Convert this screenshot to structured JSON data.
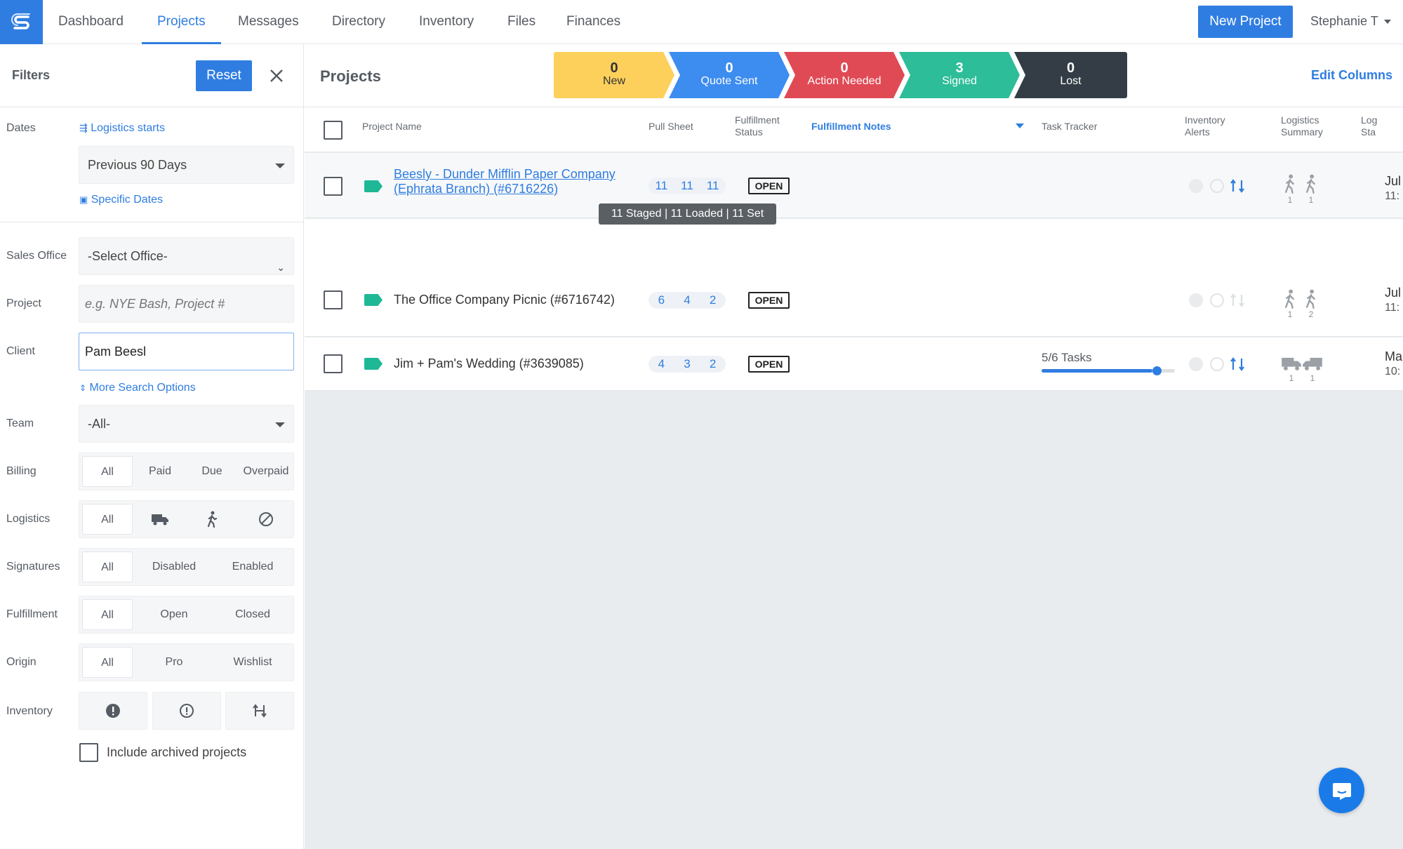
{
  "nav": {
    "items": [
      "Dashboard",
      "Projects",
      "Messages",
      "Directory",
      "Inventory",
      "Files",
      "Finances"
    ],
    "active": "Projects",
    "new_project": "New Project",
    "user": "Stephanie T"
  },
  "filters": {
    "title": "Filters",
    "reset": "Reset",
    "dates_label": "Dates",
    "logistics_starts": "Logistics starts",
    "date_range": "Previous 90 Days",
    "specific_dates": "Specific Dates",
    "sales_office_label": "Sales Office",
    "sales_office_value": "-Select Office-",
    "project_label": "Project",
    "project_placeholder": "e.g. NYE Bash, Project #",
    "client_label": "Client",
    "client_value": "Pam Beesl",
    "more_search": "More Search Options",
    "team_label": "Team",
    "team_value": "-All-",
    "billing_label": "Billing",
    "billing_options": [
      "All",
      "Paid",
      "Due",
      "Overpaid"
    ],
    "logistics_label": "Logistics",
    "logistics_all": "All",
    "signatures_label": "Signatures",
    "signatures_options": [
      "All",
      "Disabled",
      "Enabled"
    ],
    "fulfillment_label": "Fulfillment",
    "fulfillment_options": [
      "All",
      "Open",
      "Closed"
    ],
    "origin_label": "Origin",
    "origin_options": [
      "All",
      "Pro",
      "Wishlist"
    ],
    "inventory_label": "Inventory",
    "include_archived": "Include archived projects"
  },
  "main": {
    "title": "Projects",
    "edit_columns": "Edit Columns",
    "stages": [
      {
        "count": "0",
        "name": "New",
        "color": "#fdd05c"
      },
      {
        "count": "0",
        "name": "Quote Sent",
        "color": "#3d8cf0"
      },
      {
        "count": "0",
        "name": "Action Needed",
        "color": "#e04a55"
      },
      {
        "count": "3",
        "name": "Signed",
        "color": "#2dbd98"
      },
      {
        "count": "0",
        "name": "Lost",
        "color": "#343d45"
      }
    ],
    "columns": {
      "project_name": "Project Name",
      "pull_sheet": "Pull Sheet",
      "fulfillment_status_1": "Fulfillment",
      "fulfillment_status_2": "Status",
      "fulfillment_notes": "Fulfillment Notes",
      "task_tracker": "Task Tracker",
      "inventory_alerts_1": "Inventory",
      "inventory_alerts_2": "Alerts",
      "logistics_summary_1": "Logistics",
      "logistics_summary_2": "Summary",
      "logistics_start_1": "Log",
      "logistics_start_2": "Sta"
    },
    "rows": [
      {
        "name_line1": "Beesly - Dunder Mifflin Paper Company",
        "name_line2": "(Ephrata Branch) (#6716226)",
        "pull": [
          "11",
          "11",
          "11"
        ],
        "status": "OPEN",
        "logistics": [
          "1",
          "1"
        ],
        "date": "Jul",
        "time": "11:"
      },
      {
        "name_line1": "The Office Company Picnic (#6716742)",
        "pull": [
          "6",
          "4",
          "2"
        ],
        "status": "OPEN",
        "logistics": [
          "1",
          "2"
        ],
        "date": "Jul",
        "time": "11:"
      },
      {
        "name_line1": "Jim + Pam's Wedding (#3639085)",
        "pull": [
          "4",
          "3",
          "2"
        ],
        "status": "OPEN",
        "tasks": "5/6 Tasks",
        "tasks_progress": 0.83,
        "logistics": [
          "1",
          "1"
        ],
        "date": "Ma",
        "time": "10:"
      }
    ],
    "tooltip": "11 Staged | 11 Loaded | 11 Set"
  }
}
